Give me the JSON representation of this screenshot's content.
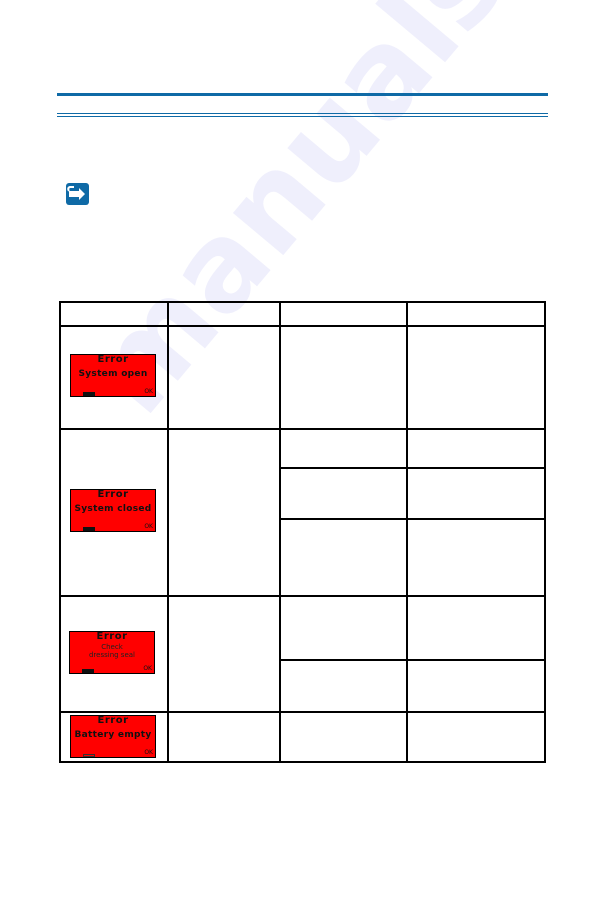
{
  "document": {
    "section_title": "",
    "note_icon": "arrow-right-note-icon",
    "accent_color": "#0f6aa6"
  },
  "table": {
    "headers": [
      "",
      "",
      "",
      ""
    ],
    "rows": [
      {
        "screen": {
          "title": "Error",
          "message": "System open",
          "battery": "full",
          "ok_icon": "OK"
        },
        "subrows": 1
      },
      {
        "screen": {
          "title": "Error",
          "message": "System closed",
          "battery": "full",
          "ok_icon": "OK"
        },
        "subrows": 3
      },
      {
        "screen": {
          "title": "Error",
          "message_line1": "Check",
          "message_line2": "dressing seal",
          "battery": "full",
          "ok_icon": "OK"
        },
        "subrows": 2
      },
      {
        "screen": {
          "title": "Error",
          "message": "Battery empty",
          "battery": "empty",
          "ok_icon": "OK"
        },
        "subrows": 1
      }
    ]
  },
  "lcd_color": "#ff0000",
  "watermark": "manualshive.com"
}
